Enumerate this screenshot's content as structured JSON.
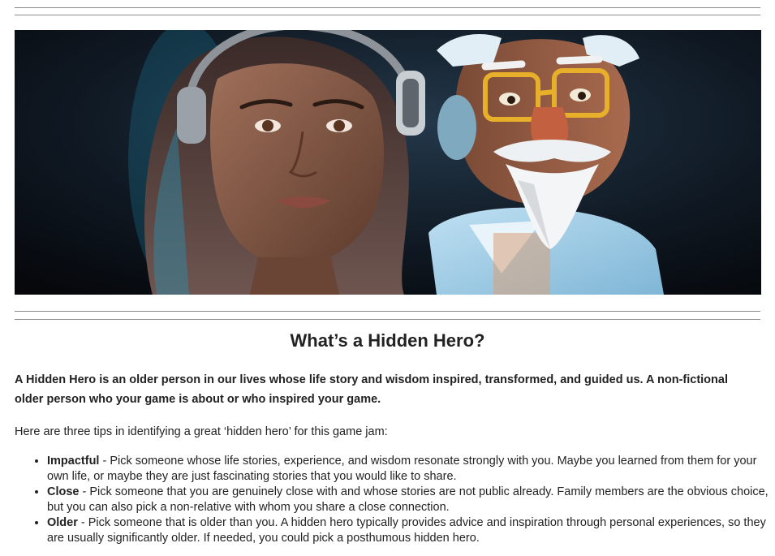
{
  "banner": {
    "image_alt": "Illustration of a young woman wearing headphones beside a 3D cartoon grandfather with glasses and a white beard"
  },
  "title": "What’s a Hidden Hero?",
  "intro": "A Hidden Hero is an older person in our lives whose life story and wisdom inspired, transformed, and guided us. A non-fictional older person who your game is about or who inspired your game.",
  "tips_lead": "Here are three tips in identifying a great ‘hidden hero’ for this game jam:",
  "tips": [
    {
      "term": "Impactful",
      "text": " - Pick someone whose life stories, experience, and wisdom resonate strongly with you. Maybe you learned from them for your own life, or maybe they are just fascinating stories that you would like to share."
    },
    {
      "term": "Close",
      "text": " - Pick someone that you are genuinely close with and whose stories are not public already. Family members are the obvious choice, but you can also pick a non-relative with whom you share a close connection."
    },
    {
      "term": "Older",
      "text": " - Pick someone that is older than you. A hidden hero typically provides advice and inspiration through personal experiences, so they are usually significantly older. If needed, you could pick a posthumous hidden hero."
    }
  ]
}
